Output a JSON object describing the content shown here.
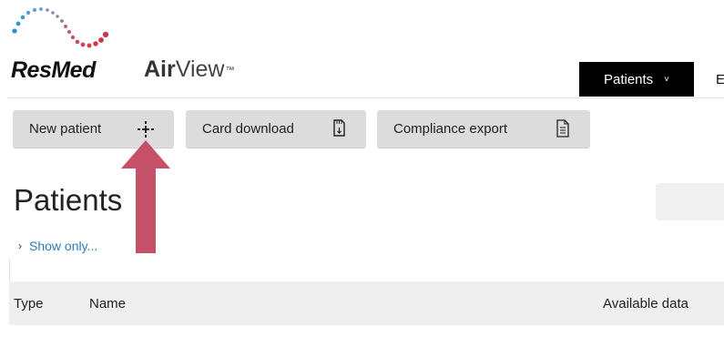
{
  "brand": {
    "logo_text": "ResMed",
    "product_part1": "Air",
    "product_part2": "View",
    "trademark": "™"
  },
  "nav": {
    "patients_label": "Patients",
    "patients_chevron": "˅",
    "next_item_partial": "E"
  },
  "toolbar": {
    "new_patient_label": "New patient",
    "card_download_label": "Card download",
    "compliance_export_label": "Compliance export"
  },
  "page": {
    "title": "Patients",
    "show_only_label": "Show only...",
    "show_only_chevron": "›"
  },
  "table": {
    "columns": [
      "Type",
      "Name",
      "Available data"
    ]
  },
  "icons": {
    "new_patient": "plus-dotted-icon",
    "card_download": "sd-card-icon",
    "compliance_export": "document-icon",
    "annotation": "up-arrow-icon"
  },
  "colors": {
    "nav_active_bg": "#000000",
    "button_bg": "#dcdcdc",
    "link": "#2f7db8",
    "annotation_arrow": "#c4506a",
    "logo_blue": "#2a8fd6",
    "logo_red": "#d1314a"
  }
}
